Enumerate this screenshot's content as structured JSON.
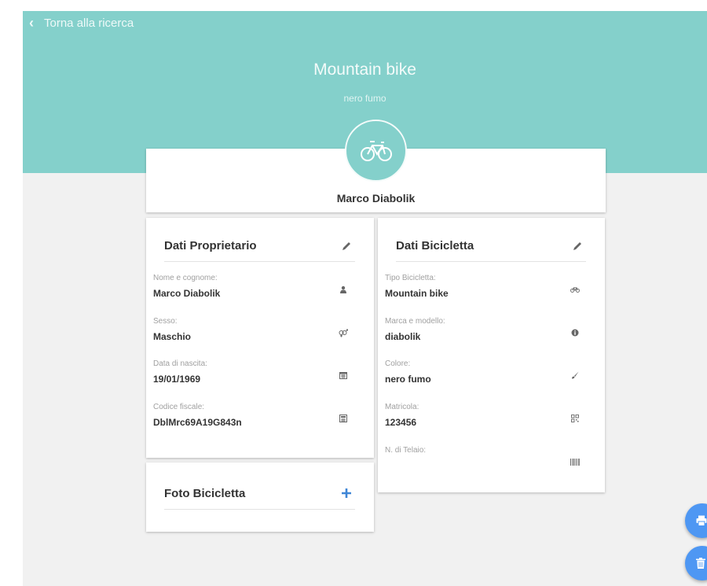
{
  "header": {
    "back_label": "Torna alla ricerca",
    "title": "Mountain bike",
    "subtitle": "nero fumo"
  },
  "owner_name": "Marco Diabolik",
  "owner_section": {
    "title": "Dati Proprietario",
    "fields": [
      {
        "label": "Nome e cognome:",
        "value": "Marco Diabolik",
        "icon": "user-icon"
      },
      {
        "label": "Sesso:",
        "value": "Maschio",
        "icon": "gender-icon"
      },
      {
        "label": "Data di nascita:",
        "value": "19/01/1969",
        "icon": "calendar-icon"
      },
      {
        "label": "Codice fiscale:",
        "value": "DblMrc69A19G843n",
        "icon": "calculator-icon"
      }
    ]
  },
  "bike_section": {
    "title": "Dati Bicicletta",
    "fields": [
      {
        "label": "Tipo Bicicletta:",
        "value": "Mountain bike",
        "icon": "bicycle-icon"
      },
      {
        "label": "Marca e modello:",
        "value": "diabolik",
        "icon": "info-icon"
      },
      {
        "label": "Colore:",
        "value": "nero fumo",
        "icon": "brush-icon"
      },
      {
        "label": "Matricola:",
        "value": "123456",
        "icon": "qrcode-icon"
      },
      {
        "label": "N. di Telaio:",
        "value": "",
        "icon": "barcode-icon"
      }
    ]
  },
  "photo_section": {
    "title": "Foto Bicicletta"
  },
  "colors": {
    "header": "#84d0cb",
    "fab": "#4e97f3",
    "add": "#3f86d6"
  }
}
